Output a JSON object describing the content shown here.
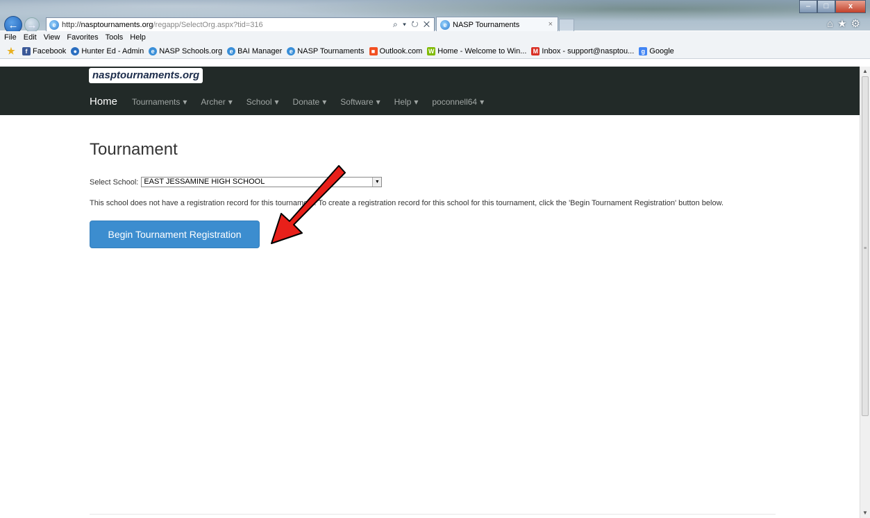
{
  "browser": {
    "url_scheme": "http://",
    "url_host": "nasptournaments.org",
    "url_path": "/regapp/SelectOrg.aspx?tid=316",
    "address_tools": "⌕ ▾ ↻ ✕",
    "tab_title": "NASP Tournaments",
    "tab_close": "×",
    "window_min": "–",
    "window_max": "□",
    "window_close": "x",
    "right_icons": "⌂★⚙"
  },
  "menu": [
    "File",
    "Edit",
    "View",
    "Favorites",
    "Tools",
    "Help"
  ],
  "favorites": [
    {
      "label": "Facebook",
      "icon": "facebook-icon",
      "color": "#3b5998",
      "glyph": "f"
    },
    {
      "label": "Hunter Ed - Admin",
      "icon": "globe-icon",
      "color": "#2a6ec0",
      "glyph": "●"
    },
    {
      "label": "NASP Schools.org",
      "icon": "ie-page-icon",
      "color": "#3a8fd8",
      "glyph": "e"
    },
    {
      "label": "BAI Manager",
      "icon": "ie-page-icon",
      "color": "#3a8fd8",
      "glyph": "e"
    },
    {
      "label": "NASP Tournaments",
      "icon": "ie-page-icon",
      "color": "#3a8fd8",
      "glyph": "e"
    },
    {
      "label": "Outlook.com",
      "icon": "windows-icon",
      "color": "#f25022",
      "glyph": "■"
    },
    {
      "label": "Home - Welcome to Win...",
      "icon": "win-site-icon",
      "color": "#7fba00",
      "glyph": "W"
    },
    {
      "label": "Inbox - support@nasptou...",
      "icon": "gmail-icon",
      "color": "#d93025",
      "glyph": "M"
    },
    {
      "label": "Google",
      "icon": "google-icon",
      "color": "#4285f4",
      "glyph": "g"
    }
  ],
  "site": {
    "brand": "nasptournaments.org",
    "nav": [
      {
        "label": "Home",
        "dropdown": false
      },
      {
        "label": "Tournaments",
        "dropdown": true
      },
      {
        "label": "Archer",
        "dropdown": true
      },
      {
        "label": "School",
        "dropdown": true
      },
      {
        "label": "Donate",
        "dropdown": true
      },
      {
        "label": "Software",
        "dropdown": true
      },
      {
        "label": "Help",
        "dropdown": true
      },
      {
        "label": "poconnell64",
        "dropdown": true
      }
    ]
  },
  "page": {
    "title": "Tournament",
    "select_label": "Select School:",
    "select_value": "EAST JESSAMINE HIGH SCHOOL",
    "note": "This school does not have a registration record for this tournament. To create a registration record for this school for this tournament, click the 'Begin Tournament Registration' button below.",
    "button_label": "Begin Tournament Registration"
  },
  "colors": {
    "navbar": "#222a28",
    "button": "#3c8dcf",
    "annotation_arrow": "#e8201a"
  }
}
